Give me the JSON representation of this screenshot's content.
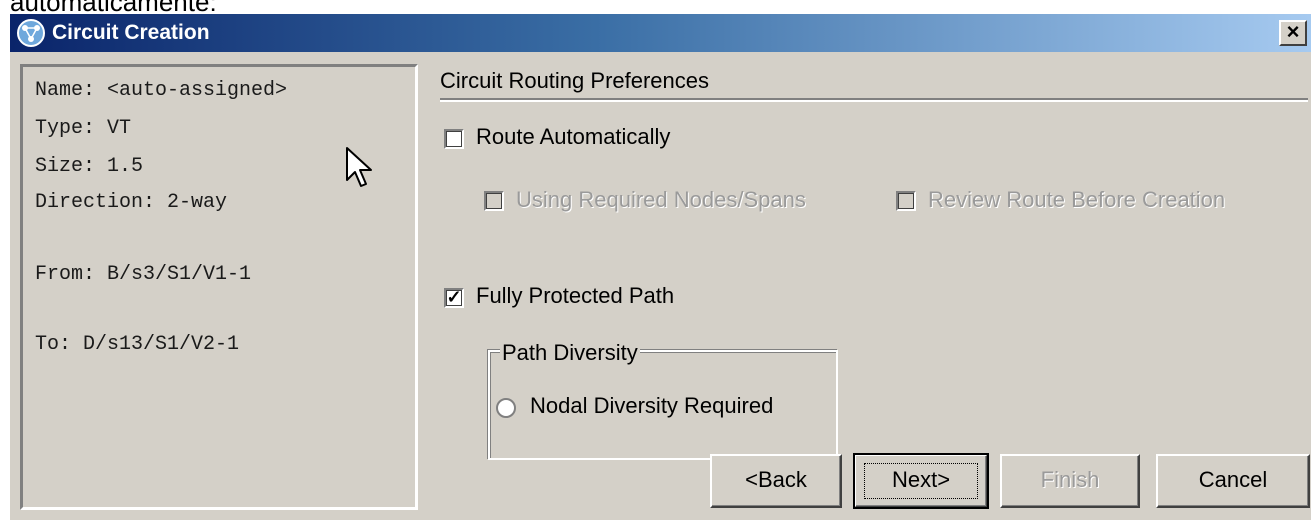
{
  "caption": "automaticamente:",
  "window": {
    "title": "Circuit Creation",
    "close_label": "×",
    "icon": "circuit-app-icon"
  },
  "summary": {
    "lines": [
      "Name: <auto-assigned>",
      "Type: VT",
      "Size: 1.5",
      "Direction: 2-way",
      "From: B/s3/S1/V1-1",
      "To: D/s13/S1/V2-1"
    ]
  },
  "routing": {
    "section_title": "Circuit Routing Preferences",
    "route_automatically": {
      "label": "Route Automatically",
      "checked": false
    },
    "using_required_nodes": {
      "label": "Using Required Nodes/Spans",
      "checked": false,
      "enabled": false
    },
    "review_route": {
      "label": "Review Route Before Creation",
      "checked": false,
      "enabled": false
    },
    "fully_protected_path": {
      "label": "Fully Protected Path",
      "checked": true
    },
    "check_glyph": "✓",
    "path_diversity": {
      "legend": "Path Diversity",
      "nodal_diversity": {
        "label": "Nodal Diversity Required",
        "selected": false
      }
    }
  },
  "buttons": {
    "back": "<Back",
    "next": "Next>",
    "finish": "Finish",
    "cancel": "Cancel"
  }
}
